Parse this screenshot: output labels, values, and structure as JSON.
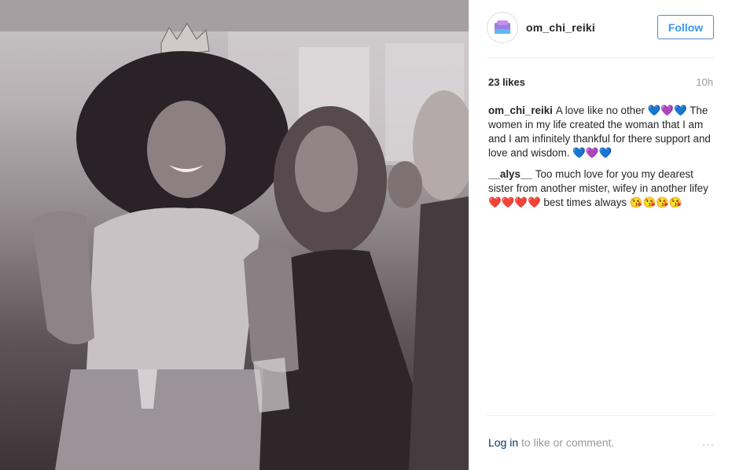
{
  "post": {
    "username": "om_chi_reiki",
    "follow_label": "Follow",
    "likes": "23 likes",
    "time": "10h",
    "comments": [
      {
        "author": "om_chi_reiki",
        "text": "A love like no other 💙💜💙 The women in my life created the woman that I am and I am infinitely thankful for there support and love and wisdom. 💙💜💙"
      },
      {
        "author": "__alys__",
        "text": "Too much love for you my dearest sister from another mister, wifey in another lifey ❤️❤️❤️❤️ best times always 😘😘😘😘"
      }
    ],
    "footer": {
      "login_label": "Log in",
      "rest": " to like or comment."
    },
    "more_icon": "···"
  },
  "colors": {
    "follow_text": "#3897f0",
    "link": "#003569",
    "muted": "#999999"
  }
}
